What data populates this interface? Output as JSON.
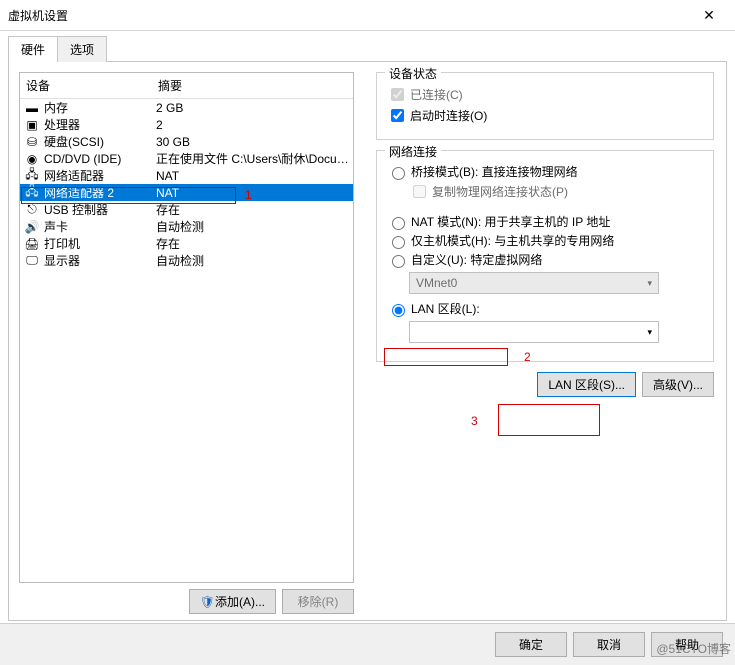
{
  "title": "虚拟机设置",
  "tabs": {
    "hardware": "硬件",
    "options": "选项"
  },
  "list": {
    "header_device": "设备",
    "header_summary": "摘要",
    "rows": [
      {
        "icon": "memory-icon",
        "name": "内存",
        "summary": "2 GB"
      },
      {
        "icon": "cpu-icon",
        "name": "处理器",
        "summary": "2"
      },
      {
        "icon": "hdd-icon",
        "name": "硬盘(SCSI)",
        "summary": "30 GB"
      },
      {
        "icon": "cd-icon",
        "name": "CD/DVD (IDE)",
        "summary": "正在使用文件 C:\\Users\\耐休\\Docum..."
      },
      {
        "icon": "net-icon",
        "name": "网络适配器",
        "summary": "NAT"
      },
      {
        "icon": "net-icon",
        "name": "网络适配器 2",
        "summary": "NAT",
        "selected": true
      },
      {
        "icon": "usb-icon",
        "name": "USB 控制器",
        "summary": "存在"
      },
      {
        "icon": "sound-icon",
        "name": "声卡",
        "summary": "自动检测"
      },
      {
        "icon": "printer-icon",
        "name": "打印机",
        "summary": "存在"
      },
      {
        "icon": "display-icon",
        "name": "显示器",
        "summary": "自动检测"
      }
    ]
  },
  "left_buttons": {
    "add": "添加(A)...",
    "remove": "移除(R)"
  },
  "device_state": {
    "title": "设备状态",
    "connected": "已连接(C)",
    "connect_at_poweron": "启动时连接(O)"
  },
  "network": {
    "title": "网络连接",
    "bridged": "桥接模式(B): 直接连接物理网络",
    "replicate": "复制物理网络连接状态(P)",
    "nat": "NAT 模式(N): 用于共享主机的 IP 地址",
    "hostonly": "仅主机模式(H): 与主机共享的专用网络",
    "custom": "自定义(U): 特定虚拟网络",
    "vmnet_sel": "VMnet0",
    "lan_seg": "LAN 区段(L):",
    "lan_sel": "",
    "btn_lan": "LAN 区段(S)...",
    "btn_adv": "高级(V)..."
  },
  "annotations": {
    "a1": "1",
    "a2": "2",
    "a3": "3"
  },
  "footer": {
    "ok": "确定",
    "cancel": "取消",
    "help": "帮助"
  },
  "watermark": "@51CTO博客"
}
